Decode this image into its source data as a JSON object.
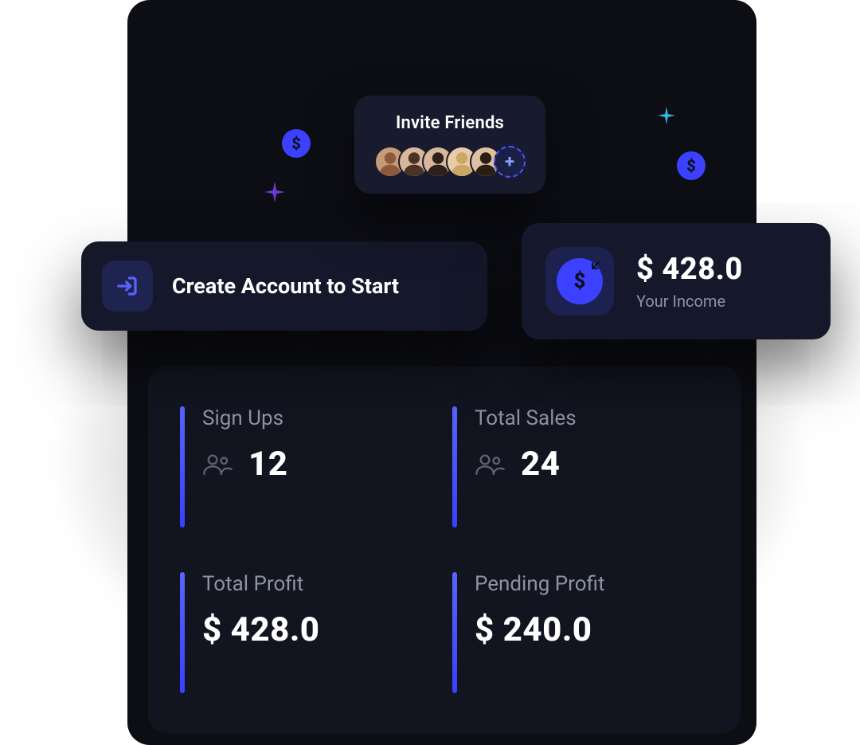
{
  "invite": {
    "title": "Invite Friends",
    "avatars": [
      {
        "name": "friend-1"
      },
      {
        "name": "friend-2"
      },
      {
        "name": "friend-3"
      },
      {
        "name": "friend-4"
      },
      {
        "name": "friend-5"
      }
    ],
    "add_label": "+"
  },
  "cta": {
    "label": "Create Account to Start"
  },
  "income": {
    "value": "$ 428.0",
    "label": "Your Income"
  },
  "stats": {
    "signUps": {
      "label": "Sign Ups",
      "value": "12"
    },
    "totalSales": {
      "label": "Total Sales",
      "value": "24"
    },
    "totalProfit": {
      "label": "Total Profit",
      "value": "$ 428.0"
    },
    "pendingProfit": {
      "label": "Pending Profit",
      "value": "$ 240.0"
    }
  }
}
